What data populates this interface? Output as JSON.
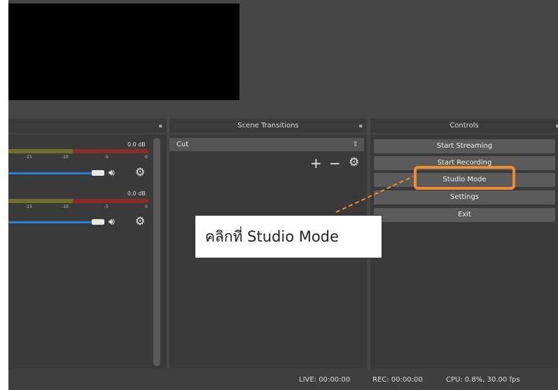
{
  "mixer": {
    "channels": [
      {
        "db": "0.0 dB",
        "ticks": [
          "-15",
          "-10",
          "-5",
          "0"
        ]
      },
      {
        "db": "0.0 dB",
        "ticks": [
          "-15",
          "-10",
          "-5",
          "0"
        ]
      }
    ]
  },
  "transitions": {
    "title": "Scene Transitions",
    "selected": "Cut",
    "add_label": "+",
    "remove_label": "−",
    "gear_label": "⚙"
  },
  "controls": {
    "title": "Controls",
    "buttons": {
      "start_streaming": "Start Streaming",
      "start_recording": "Start Recording",
      "studio_mode": "Studio Mode",
      "settings": "Settings",
      "exit": "Exit"
    }
  },
  "annotation": {
    "text": "คลิกที่ Studio Mode",
    "highlight_color": "#f28c28"
  },
  "status": {
    "live": "LIVE: 00:00:00",
    "rec": "REC: 00:00:00",
    "cpu": "CPU: 0.8%, 30.00 fps"
  }
}
